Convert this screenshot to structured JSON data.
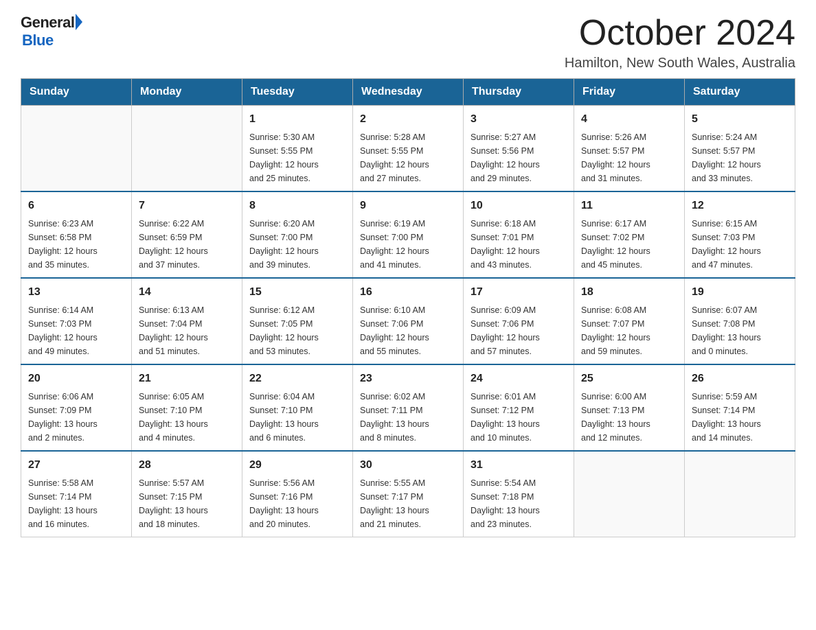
{
  "header": {
    "logo_general": "General",
    "logo_blue": "Blue",
    "title": "October 2024",
    "subtitle": "Hamilton, New South Wales, Australia"
  },
  "days_of_week": [
    "Sunday",
    "Monday",
    "Tuesday",
    "Wednesday",
    "Thursday",
    "Friday",
    "Saturday"
  ],
  "weeks": [
    {
      "days": [
        {
          "number": "",
          "info": ""
        },
        {
          "number": "",
          "info": ""
        },
        {
          "number": "1",
          "info": "Sunrise: 5:30 AM\nSunset: 5:55 PM\nDaylight: 12 hours\nand 25 minutes."
        },
        {
          "number": "2",
          "info": "Sunrise: 5:28 AM\nSunset: 5:55 PM\nDaylight: 12 hours\nand 27 minutes."
        },
        {
          "number": "3",
          "info": "Sunrise: 5:27 AM\nSunset: 5:56 PM\nDaylight: 12 hours\nand 29 minutes."
        },
        {
          "number": "4",
          "info": "Sunrise: 5:26 AM\nSunset: 5:57 PM\nDaylight: 12 hours\nand 31 minutes."
        },
        {
          "number": "5",
          "info": "Sunrise: 5:24 AM\nSunset: 5:57 PM\nDaylight: 12 hours\nand 33 minutes."
        }
      ]
    },
    {
      "days": [
        {
          "number": "6",
          "info": "Sunrise: 6:23 AM\nSunset: 6:58 PM\nDaylight: 12 hours\nand 35 minutes."
        },
        {
          "number": "7",
          "info": "Sunrise: 6:22 AM\nSunset: 6:59 PM\nDaylight: 12 hours\nand 37 minutes."
        },
        {
          "number": "8",
          "info": "Sunrise: 6:20 AM\nSunset: 7:00 PM\nDaylight: 12 hours\nand 39 minutes."
        },
        {
          "number": "9",
          "info": "Sunrise: 6:19 AM\nSunset: 7:00 PM\nDaylight: 12 hours\nand 41 minutes."
        },
        {
          "number": "10",
          "info": "Sunrise: 6:18 AM\nSunset: 7:01 PM\nDaylight: 12 hours\nand 43 minutes."
        },
        {
          "number": "11",
          "info": "Sunrise: 6:17 AM\nSunset: 7:02 PM\nDaylight: 12 hours\nand 45 minutes."
        },
        {
          "number": "12",
          "info": "Sunrise: 6:15 AM\nSunset: 7:03 PM\nDaylight: 12 hours\nand 47 minutes."
        }
      ]
    },
    {
      "days": [
        {
          "number": "13",
          "info": "Sunrise: 6:14 AM\nSunset: 7:03 PM\nDaylight: 12 hours\nand 49 minutes."
        },
        {
          "number": "14",
          "info": "Sunrise: 6:13 AM\nSunset: 7:04 PM\nDaylight: 12 hours\nand 51 minutes."
        },
        {
          "number": "15",
          "info": "Sunrise: 6:12 AM\nSunset: 7:05 PM\nDaylight: 12 hours\nand 53 minutes."
        },
        {
          "number": "16",
          "info": "Sunrise: 6:10 AM\nSunset: 7:06 PM\nDaylight: 12 hours\nand 55 minutes."
        },
        {
          "number": "17",
          "info": "Sunrise: 6:09 AM\nSunset: 7:06 PM\nDaylight: 12 hours\nand 57 minutes."
        },
        {
          "number": "18",
          "info": "Sunrise: 6:08 AM\nSunset: 7:07 PM\nDaylight: 12 hours\nand 59 minutes."
        },
        {
          "number": "19",
          "info": "Sunrise: 6:07 AM\nSunset: 7:08 PM\nDaylight: 13 hours\nand 0 minutes."
        }
      ]
    },
    {
      "days": [
        {
          "number": "20",
          "info": "Sunrise: 6:06 AM\nSunset: 7:09 PM\nDaylight: 13 hours\nand 2 minutes."
        },
        {
          "number": "21",
          "info": "Sunrise: 6:05 AM\nSunset: 7:10 PM\nDaylight: 13 hours\nand 4 minutes."
        },
        {
          "number": "22",
          "info": "Sunrise: 6:04 AM\nSunset: 7:10 PM\nDaylight: 13 hours\nand 6 minutes."
        },
        {
          "number": "23",
          "info": "Sunrise: 6:02 AM\nSunset: 7:11 PM\nDaylight: 13 hours\nand 8 minutes."
        },
        {
          "number": "24",
          "info": "Sunrise: 6:01 AM\nSunset: 7:12 PM\nDaylight: 13 hours\nand 10 minutes."
        },
        {
          "number": "25",
          "info": "Sunrise: 6:00 AM\nSunset: 7:13 PM\nDaylight: 13 hours\nand 12 minutes."
        },
        {
          "number": "26",
          "info": "Sunrise: 5:59 AM\nSunset: 7:14 PM\nDaylight: 13 hours\nand 14 minutes."
        }
      ]
    },
    {
      "days": [
        {
          "number": "27",
          "info": "Sunrise: 5:58 AM\nSunset: 7:14 PM\nDaylight: 13 hours\nand 16 minutes."
        },
        {
          "number": "28",
          "info": "Sunrise: 5:57 AM\nSunset: 7:15 PM\nDaylight: 13 hours\nand 18 minutes."
        },
        {
          "number": "29",
          "info": "Sunrise: 5:56 AM\nSunset: 7:16 PM\nDaylight: 13 hours\nand 20 minutes."
        },
        {
          "number": "30",
          "info": "Sunrise: 5:55 AM\nSunset: 7:17 PM\nDaylight: 13 hours\nand 21 minutes."
        },
        {
          "number": "31",
          "info": "Sunrise: 5:54 AM\nSunset: 7:18 PM\nDaylight: 13 hours\nand 23 minutes."
        },
        {
          "number": "",
          "info": ""
        },
        {
          "number": "",
          "info": ""
        }
      ]
    }
  ],
  "colors": {
    "header_bg": "#1a6496",
    "header_text": "#ffffff",
    "border": "#cccccc",
    "accent": "#1565c0"
  }
}
